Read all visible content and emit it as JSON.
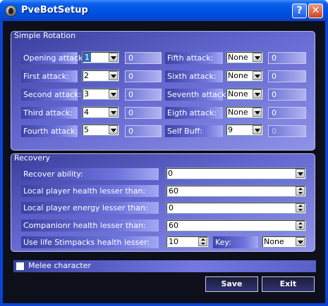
{
  "window": {
    "title": "PveBotSetup",
    "help_label": "?",
    "close_label": "✕"
  },
  "rotation": {
    "group_label": "Simple Rotation",
    "left": [
      {
        "label": "Opening attack:",
        "value": "1",
        "number": "0"
      },
      {
        "label": "First attack:",
        "value": "2",
        "number": "0"
      },
      {
        "label": "Second attack:",
        "value": "3",
        "number": "0"
      },
      {
        "label": "Third attack:",
        "value": "4",
        "number": "0"
      },
      {
        "label": "Fourth attack:",
        "value": "5",
        "number": "0"
      }
    ],
    "right": [
      {
        "label": "Fifth attack:",
        "value": "None",
        "number": "0"
      },
      {
        "label": "Sixth attack:",
        "value": "None",
        "number": "0"
      },
      {
        "label": "Seventh attack:",
        "value": "None",
        "number": "0"
      },
      {
        "label": "Eigth attack:",
        "value": "None",
        "number": "0"
      },
      {
        "label": "Self Buff:",
        "value": "9",
        "number": "0"
      }
    ]
  },
  "recovery": {
    "group_label": "Recovery",
    "ability_label": "Recover ability:",
    "ability_value": "0",
    "health_label": "Local player health lesser than:",
    "health_value": "60",
    "energy_label": "Local player energy lesser than:",
    "energy_value": "0",
    "companion_label": "Companionr health lesser than:",
    "companion_value": "60",
    "stim_label": "Use life Stimpacks health lesser:",
    "stim_value": "10",
    "key_label": "Key:",
    "key_value": "None"
  },
  "melee": {
    "label": "Melee character",
    "checked": false
  },
  "buttons": {
    "save": "Save",
    "exit": "Exit"
  },
  "colors": {
    "titlebar": "#0054e3",
    "panel": "#6467cf",
    "background": "#0d0f1a"
  }
}
